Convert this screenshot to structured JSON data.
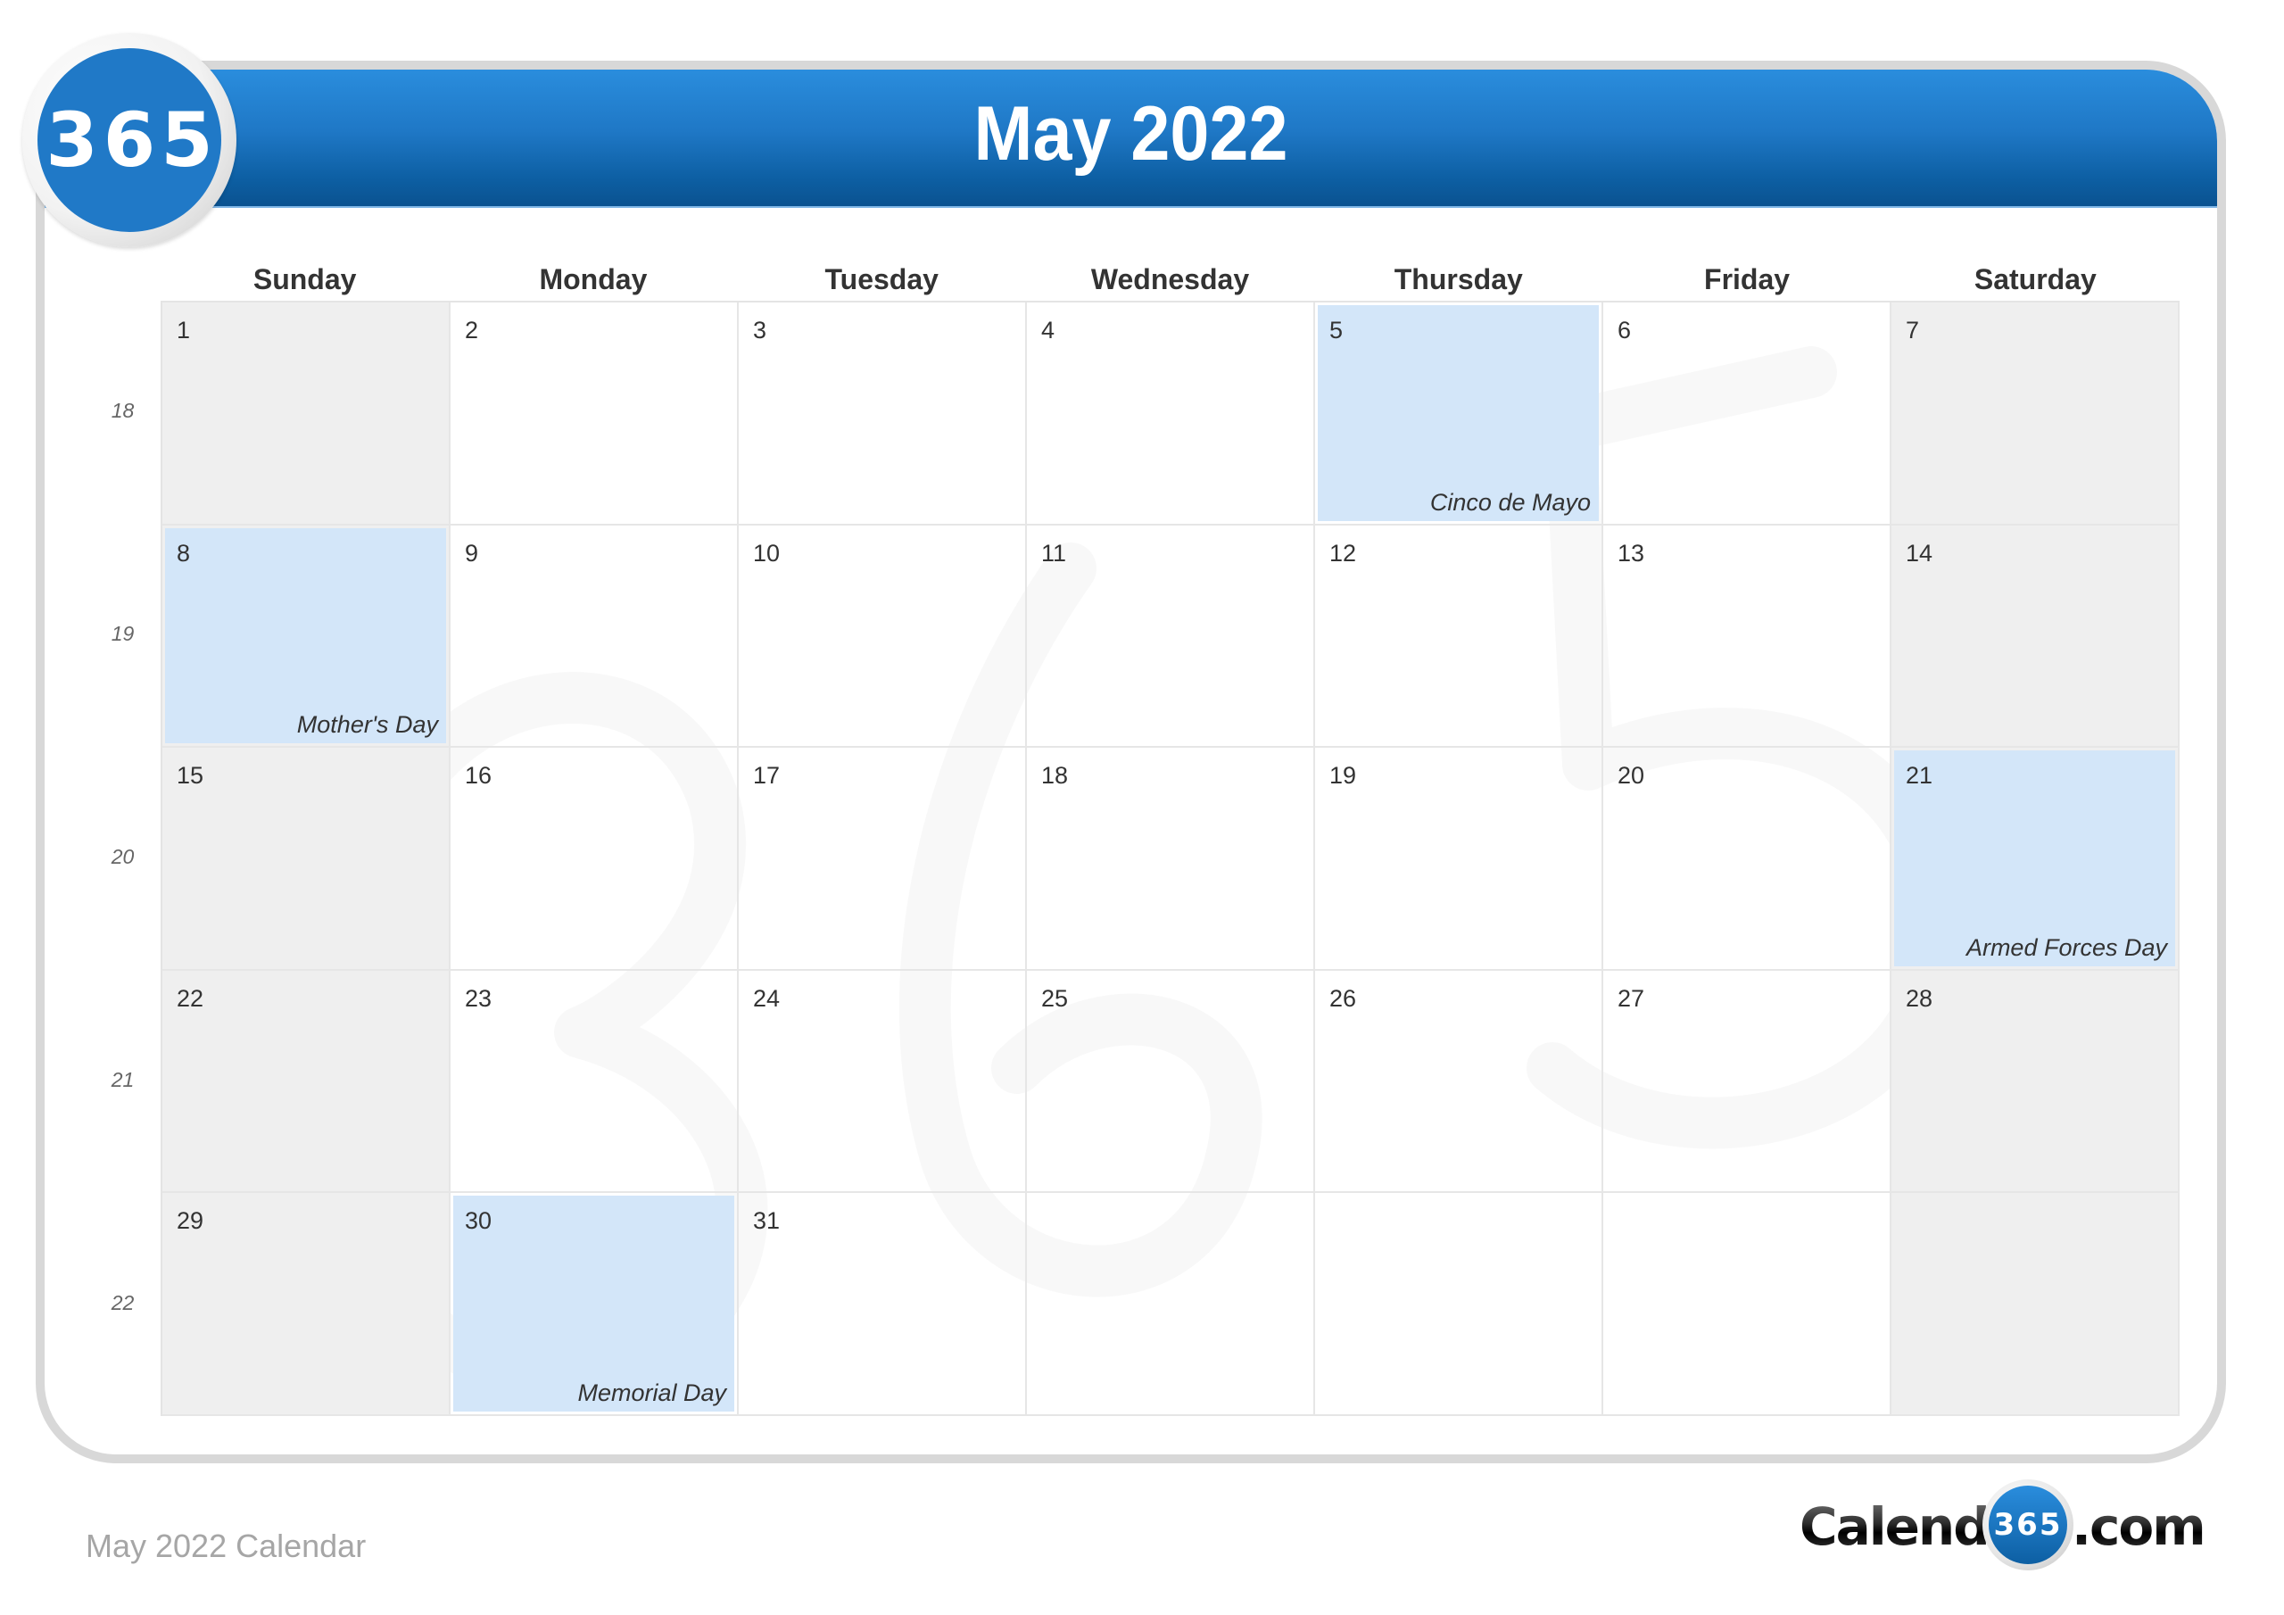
{
  "header": {
    "title": "May 2022",
    "badge_text": "365"
  },
  "weekdays": [
    "Sunday",
    "Monday",
    "Tuesday",
    "Wednesday",
    "Thursday",
    "Friday",
    "Saturday"
  ],
  "week_numbers": [
    "18",
    "19",
    "20",
    "21",
    "22"
  ],
  "weeks": [
    [
      {
        "day": "1",
        "holiday": "",
        "weekend": true
      },
      {
        "day": "2",
        "holiday": ""
      },
      {
        "day": "3",
        "holiday": ""
      },
      {
        "day": "4",
        "holiday": ""
      },
      {
        "day": "5",
        "holiday": "Cinco de Mayo"
      },
      {
        "day": "6",
        "holiday": ""
      },
      {
        "day": "7",
        "holiday": "",
        "weekend": true
      }
    ],
    [
      {
        "day": "8",
        "holiday": "Mother's Day",
        "weekend": true
      },
      {
        "day": "9",
        "holiday": ""
      },
      {
        "day": "10",
        "holiday": ""
      },
      {
        "day": "11",
        "holiday": ""
      },
      {
        "day": "12",
        "holiday": ""
      },
      {
        "day": "13",
        "holiday": ""
      },
      {
        "day": "14",
        "holiday": "",
        "weekend": true
      }
    ],
    [
      {
        "day": "15",
        "holiday": "",
        "weekend": true
      },
      {
        "day": "16",
        "holiday": ""
      },
      {
        "day": "17",
        "holiday": ""
      },
      {
        "day": "18",
        "holiday": ""
      },
      {
        "day": "19",
        "holiday": ""
      },
      {
        "day": "20",
        "holiday": ""
      },
      {
        "day": "21",
        "holiday": "Armed Forces Day",
        "weekend": true
      }
    ],
    [
      {
        "day": "22",
        "holiday": "",
        "weekend": true
      },
      {
        "day": "23",
        "holiday": ""
      },
      {
        "day": "24",
        "holiday": ""
      },
      {
        "day": "25",
        "holiday": ""
      },
      {
        "day": "26",
        "holiday": ""
      },
      {
        "day": "27",
        "holiday": ""
      },
      {
        "day": "28",
        "holiday": "",
        "weekend": true
      }
    ],
    [
      {
        "day": "29",
        "holiday": "",
        "weekend": true
      },
      {
        "day": "30",
        "holiday": "Memorial Day"
      },
      {
        "day": "31",
        "holiday": ""
      },
      {
        "day": "",
        "holiday": ""
      },
      {
        "day": "",
        "holiday": ""
      },
      {
        "day": "",
        "holiday": ""
      },
      {
        "day": "",
        "holiday": "",
        "weekend": true
      }
    ]
  ],
  "colors": {
    "header_top": "#2a8ddd",
    "header_bottom": "#0a5290",
    "badge_blue": "#2079c7",
    "holiday_fill": "#d3e6f9",
    "weekend_fill": "#eeeeee",
    "card_border": "#d8d8d8"
  },
  "footer": {
    "caption": "May 2022 Calendar",
    "logo_left": "Calendar-",
    "logo_badge": "365",
    "logo_right": ".com"
  }
}
